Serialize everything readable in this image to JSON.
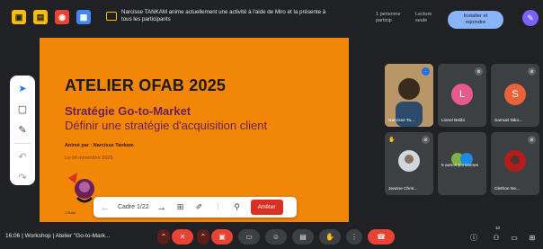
{
  "topbar": {
    "banner_text_line1": "Narcisse TANKAM anime actuellement une activité à l'aide de Miro et la présente à",
    "banner_text_line2": "tous les participants",
    "participants_label_line1": "1 personne",
    "participants_label_line2": "particip",
    "readonly_label_line1": "Lecture",
    "readonly_label_line2": "seule",
    "install_label_line1": "Installer et",
    "install_label_line2": "rejoindre",
    "icon_colors": [
      "#fbbc04",
      "#fbbc04",
      "#ea4335",
      "#4285f4"
    ]
  },
  "slide": {
    "title": "ATELIER OFAB 2025",
    "subtitle_bold": "Stratégie Go-to-Market",
    "subtitle": "Définir une stratégie d'acquisition client",
    "animated_by": "Animé par : Narcisse Tankam",
    "date": "Le 04 novembre 2025",
    "logo_label": "O'Babi",
    "background": "#f28707"
  },
  "presentation_controls": {
    "frame_label": "Cadre 1/22",
    "stop_label": "Arrêter"
  },
  "participants": [
    {
      "name": "Narcisse Ta...",
      "type": "video"
    },
    {
      "name": "Lionel Beiibi",
      "initial": "L",
      "color": "#e65a8c"
    },
    {
      "name": "Samuel Diko...",
      "initial": "S",
      "color": "#e8633a"
    },
    {
      "name": "Jeanne Chris...",
      "type": "video-hand"
    },
    {
      "name": "6 autres personnes",
      "type": "group"
    },
    {
      "name": "Clethon Ne...",
      "type": "video"
    }
  ],
  "bottombar": {
    "meeting_info": "16:06 | Workshop | Atelier \"Go-to-Mark...",
    "participant_count": "10"
  }
}
